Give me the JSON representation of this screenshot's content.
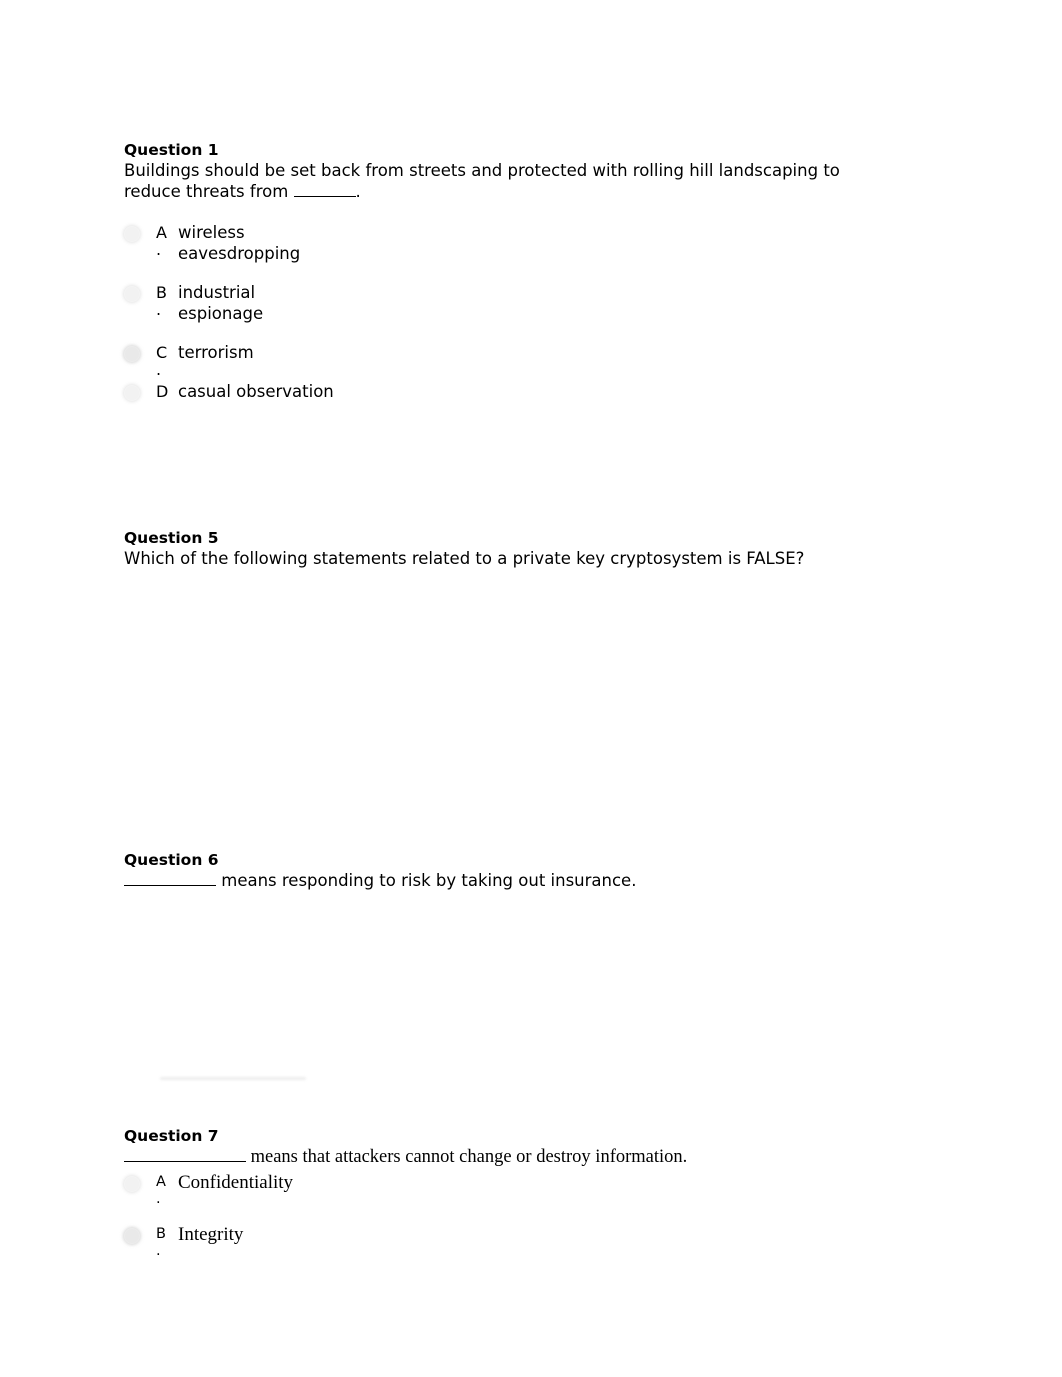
{
  "document": {
    "page_background": "#ffffff",
    "text_color": "#000000"
  },
  "questions": [
    {
      "heading": "Question 1",
      "prompt_before_blank": "Buildings should be set back from streets and protected with rolling hill landscaping to reduce threats from ",
      "prompt_after_blank": ".",
      "options": [
        {
          "letter": "A",
          "dot": ".",
          "text": "wireless\neavesdropping"
        },
        {
          "letter": "B",
          "dot": ".",
          "text": "industrial\nespionage"
        },
        {
          "letter": "C",
          "dot": ".",
          "text": "terrorism"
        },
        {
          "letter": "D",
          "dot": "",
          "text": "casual observation"
        }
      ]
    },
    {
      "heading": "Question 5",
      "prompt_before_blank": "Which of the following statements related to a private key cryptosystem is FALSE?",
      "prompt_after_blank": "",
      "options": []
    },
    {
      "heading": "Question 6",
      "prompt_before_blank": "",
      "prompt_after_blank": " means responding to risk by taking out insurance.",
      "options": []
    },
    {
      "heading": "Question 7",
      "prompt_before_blank": "",
      "prompt_after_blank": " means that attackers cannot change or destroy information.",
      "options": [
        {
          "letter": "A",
          "dot": ".",
          "text": "Confidentiality"
        },
        {
          "letter": "B",
          "dot": ".",
          "text": "Integrity"
        }
      ]
    }
  ]
}
